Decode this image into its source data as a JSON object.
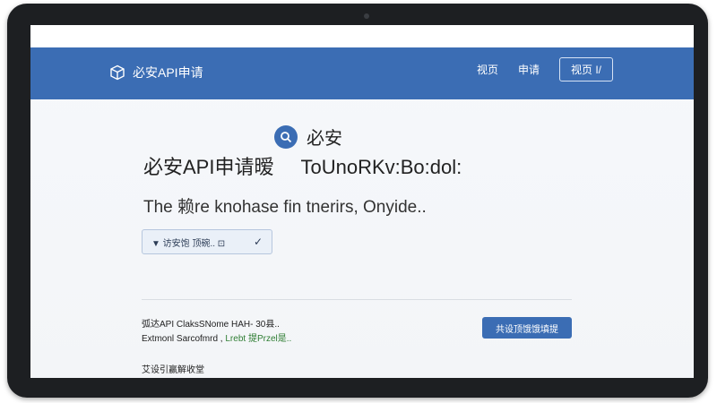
{
  "header": {
    "brand": "必安API申请",
    "nav": [
      "视页",
      "申请"
    ],
    "nav_button": "视页 I/"
  },
  "hero": {
    "badge_label": "必安",
    "title_left": "必安API申请暧",
    "title_right": "ToUnoRKv:Bo:dol:",
    "subtitle": "The 赖re knohase fin tnerirs, Onyide..",
    "select_value": "▼ 访安饱  顶碗..  ⊡"
  },
  "info": {
    "line1": "弧达API ClaksSNome HAH- 30县..",
    "line2_a": "Extmonl Sarcofmrd ,",
    "line2_b": "Lrebt 提Przel是.."
  },
  "cta": {
    "label": "共设顶饿饿填提"
  },
  "footer": {
    "text": "艾设引赢解收堂"
  },
  "colors": {
    "accent": "#3b6db4",
    "bezel": "#1d1f22",
    "green_text": "#2e7d32"
  }
}
